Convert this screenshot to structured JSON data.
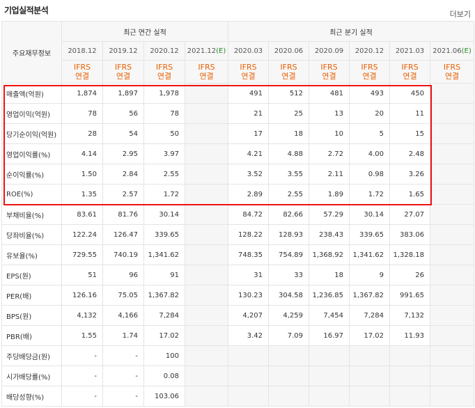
{
  "title": "기업실적분석",
  "more_label": "더보기",
  "header": {
    "corner_label": "주요재무정보",
    "annual_label": "최근 연간 실적",
    "quarter_label": "최근 분기 실적",
    "annual_periods": [
      "2018.12",
      "2019.12",
      "2020.12",
      "2021.12(E)"
    ],
    "quarter_periods": [
      "2020.03",
      "2020.06",
      "2020.09",
      "2020.12",
      "2021.03",
      "2021.06(E)"
    ],
    "basis_top": "IFRS",
    "basis_bottom": "연결"
  },
  "rows": [
    {
      "label": "매출액(억원)",
      "values": [
        "1,874",
        "1,897",
        "1,978",
        "",
        "491",
        "512",
        "481",
        "493",
        "450",
        ""
      ]
    },
    {
      "label": "영업이익(억원)",
      "values": [
        "78",
        "56",
        "78",
        "",
        "21",
        "25",
        "13",
        "20",
        "11",
        ""
      ]
    },
    {
      "label": "당기순이익(억원)",
      "values": [
        "28",
        "54",
        "50",
        "",
        "17",
        "18",
        "10",
        "5",
        "15",
        ""
      ]
    },
    {
      "label": "영업이익률(%)",
      "values": [
        "4.14",
        "2.95",
        "3.97",
        "",
        "4.21",
        "4.88",
        "2.72",
        "4.00",
        "2.48",
        ""
      ]
    },
    {
      "label": "순이익률(%)",
      "values": [
        "1.50",
        "2.84",
        "2.55",
        "",
        "3.52",
        "3.55",
        "2.11",
        "0.98",
        "3.26",
        ""
      ]
    },
    {
      "label": "ROE(%)",
      "values": [
        "1.35",
        "2.57",
        "1.72",
        "",
        "2.89",
        "2.55",
        "1.89",
        "1.72",
        "1.65",
        ""
      ]
    },
    {
      "label": "부채비율(%)",
      "values": [
        "83.61",
        "81.76",
        "30.14",
        "",
        "84.72",
        "82.66",
        "57.29",
        "30.14",
        "27.07",
        ""
      ]
    },
    {
      "label": "당좌비율(%)",
      "values": [
        "122.24",
        "126.47",
        "339.65",
        "",
        "128.22",
        "128.93",
        "238.43",
        "339.65",
        "383.06",
        ""
      ]
    },
    {
      "label": "유보율(%)",
      "values": [
        "729.55",
        "740.19",
        "1,341.62",
        "",
        "748.35",
        "754.89",
        "1,368.92",
        "1,341.62",
        "1,328.18",
        ""
      ]
    },
    {
      "label": "EPS(원)",
      "values": [
        "51",
        "96",
        "91",
        "",
        "31",
        "33",
        "18",
        "9",
        "26",
        ""
      ]
    },
    {
      "label": "PER(배)",
      "values": [
        "126.16",
        "75.05",
        "1,367.82",
        "",
        "130.23",
        "304.58",
        "1,236.85",
        "1,367.82",
        "991.65",
        ""
      ]
    },
    {
      "label": "BPS(원)",
      "values": [
        "4,132",
        "4,166",
        "7,284",
        "",
        "4,207",
        "4,259",
        "7,454",
        "7,284",
        "7,132",
        ""
      ]
    },
    {
      "label": "PBR(배)",
      "values": [
        "1.55",
        "1.74",
        "17.02",
        "",
        "3.42",
        "7.09",
        "16.97",
        "17.02",
        "11.93",
        ""
      ]
    },
    {
      "label": "주당배당금(원)",
      "values": [
        "-",
        "-",
        "100",
        "",
        "",
        "",
        "",
        "",
        "",
        ""
      ]
    },
    {
      "label": "시가배당률(%)",
      "values": [
        "-",
        "-",
        "0.08",
        "",
        "",
        "",
        "",
        "",
        "",
        ""
      ]
    },
    {
      "label": "배당성향(%)",
      "values": [
        "-",
        "-",
        "103.06",
        "",
        "",
        "",
        "",
        "",
        "",
        ""
      ]
    }
  ],
  "colors": {
    "basis_text": "#e85e00",
    "estimate_text": "#2a8a2a",
    "highlight_box": "#ee1111",
    "header_bg": "#f7f7f7"
  }
}
